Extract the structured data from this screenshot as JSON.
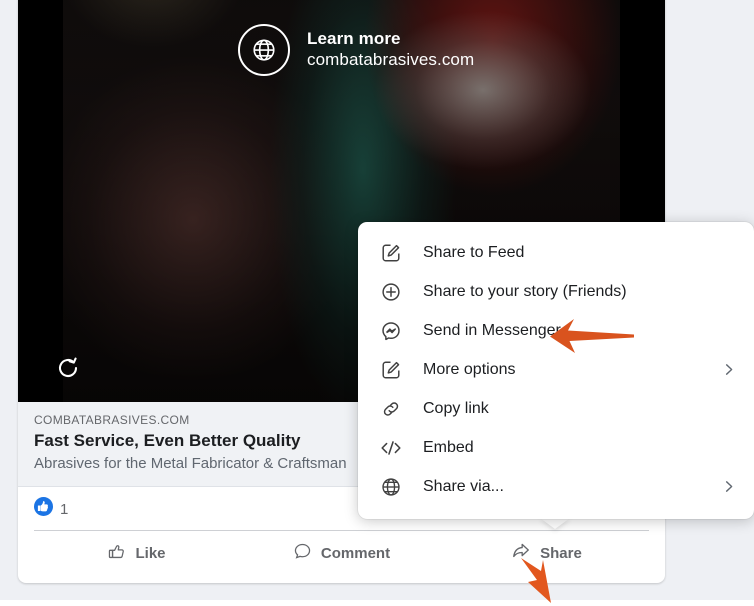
{
  "post": {
    "video": {
      "learn_more_label": "Learn more",
      "url_label": "combatabrasives.com",
      "globe_icon": "globe-icon",
      "replay_icon": "replay-icon"
    },
    "link_preview": {
      "domain": "COMBATABRASIVES.COM",
      "title": "Fast Service, Even Better Quality",
      "description": "Abrasives for the Metal Fabricator & Craftsman"
    },
    "reactions": {
      "like_icon": "thumbs-up-reaction-icon",
      "count": "1"
    },
    "actions": [
      {
        "label": "Like",
        "icon": "thumbs-up-outline-icon"
      },
      {
        "label": "Comment",
        "icon": "comment-bubble-icon"
      },
      {
        "label": "Share",
        "icon": "share-arrow-icon"
      }
    ]
  },
  "share_menu": {
    "items": [
      {
        "label": "Share to Feed",
        "icon": "pencil-square-icon",
        "chevron": false
      },
      {
        "label": "Share to your story (Friends)",
        "icon": "plus-circle-icon",
        "chevron": false
      },
      {
        "label": "Send in Messenger",
        "icon": "messenger-icon",
        "chevron": false
      },
      {
        "label": "More options",
        "icon": "pencil-square-icon",
        "chevron": true
      },
      {
        "label": "Copy link",
        "icon": "chain-link-icon",
        "chevron": false
      },
      {
        "label": "Embed",
        "icon": "code-brackets-icon",
        "chevron": false
      },
      {
        "label": "Share via...",
        "icon": "globe-icon",
        "chevron": true
      }
    ]
  },
  "annotations": [
    {
      "name": "arrow-pointing-to-send-in-messenger",
      "color": "#d9531e",
      "direction": "left"
    },
    {
      "name": "arrow-pointing-to-share-button",
      "color": "#e2571e",
      "direction": "up-left"
    }
  ],
  "colors": {
    "page_background": "#eef0f4",
    "card_background": "#ffffff",
    "link_preview_background": "#f0f2f5",
    "text_primary": "#1c1e21",
    "text_secondary": "#65676b",
    "reaction_blue": "#1b74e4",
    "annotation_orange": "#d9531e"
  }
}
